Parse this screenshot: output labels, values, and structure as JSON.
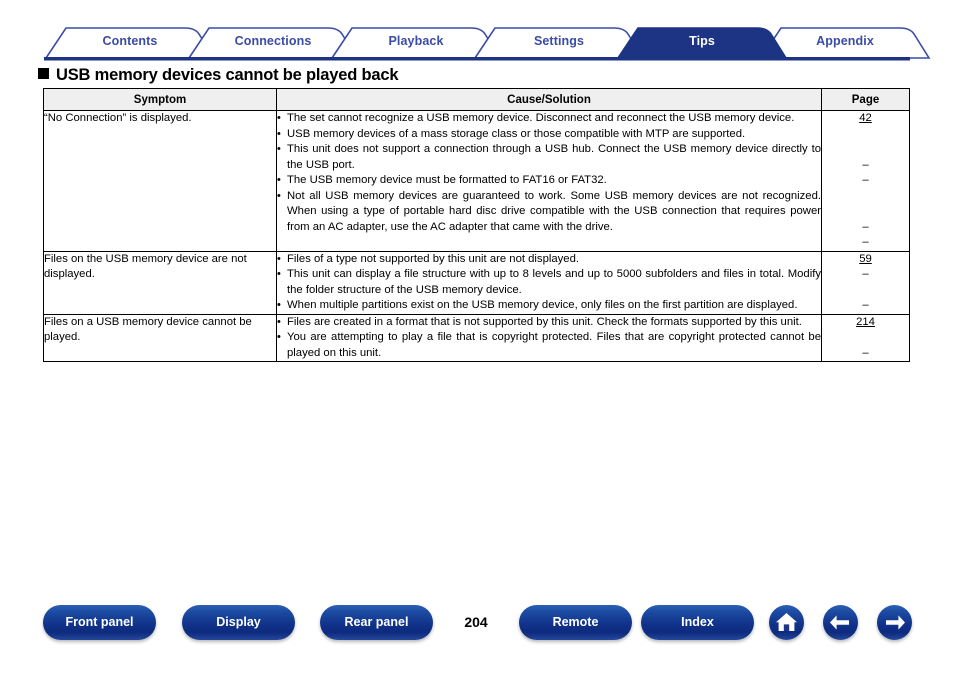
{
  "tabs": [
    {
      "label": "Contents",
      "active": false
    },
    {
      "label": "Connections",
      "active": false
    },
    {
      "label": "Playback",
      "active": false
    },
    {
      "label": "Settings",
      "active": false
    },
    {
      "label": "Tips",
      "active": true
    },
    {
      "label": "Appendix",
      "active": false
    }
  ],
  "heading": "USB memory devices cannot be played back",
  "table": {
    "headers": {
      "symptom": "Symptom",
      "cause": "Cause/Solution",
      "page": "Page"
    },
    "rows": [
      {
        "symptom": "“No Connection” is displayed.",
        "causes": [
          "The set cannot recognize a USB memory device. Disconnect and reconnect the USB memory device.",
          "USB memory devices of a mass storage class or those compatible with MTP are supported.",
          "This unit does not support a connection through a USB hub. Connect the USB memory device directly to the USB port.",
          "The USB memory device must be formatted to FAT16 or FAT32.",
          "Not all USB memory devices are guaranteed to work. Some USB memory devices are not recognized. When using a type of portable hard disc drive compatible with the USB connection that requires power from an AC adapter, use the AC adapter that came with the drive."
        ],
        "pages": [
          {
            "text": "42",
            "link": true,
            "offset": 0
          },
          {
            "text": "–",
            "link": false,
            "offset": 2
          },
          {
            "text": "–",
            "link": false,
            "offset": 0
          },
          {
            "text": "–",
            "link": false,
            "offset": 2
          },
          {
            "text": "–",
            "link": false,
            "offset": 0
          }
        ]
      },
      {
        "symptom": "Files on the USB memory device are not displayed.",
        "causes": [
          "Files of a type not supported by this unit are not displayed.",
          "This unit can display a file structure with up to 8 levels and up to 5000 subfolders and files in total. Modify the folder structure of the USB memory device.",
          "When multiple partitions exist on the USB memory device, only files on the first partition are displayed."
        ],
        "pages": [
          {
            "text": "59",
            "link": true,
            "offset": 0
          },
          {
            "text": "–",
            "link": false,
            "offset": 0
          },
          {
            "text": "–",
            "link": false,
            "offset": 1
          }
        ]
      },
      {
        "symptom": "Files on a USB memory device cannot be played.",
        "causes": [
          "Files are created in a format that is not supported by this unit. Check the formats supported by this unit.",
          "You are attempting to play a file that is copyright protected. Files that are copyright protected cannot be played on this unit."
        ],
        "pages": [
          {
            "text": "214",
            "link": true,
            "offset": 0
          },
          {
            "text": "–",
            "link": false,
            "offset": 1
          }
        ]
      }
    ]
  },
  "footer": {
    "buttons": [
      {
        "label": "Front panel"
      },
      {
        "label": "Display"
      },
      {
        "label": "Rear panel"
      },
      {
        "label": "Remote"
      },
      {
        "label": "Index"
      }
    ],
    "page_number": "204",
    "icons": [
      {
        "name": "home-icon"
      },
      {
        "name": "back-arrow-icon"
      },
      {
        "name": "forward-arrow-icon"
      }
    ]
  },
  "colors": {
    "accent": "#1d3383",
    "tab_text": "#3b4ba8",
    "header_fill": "#efefef"
  }
}
